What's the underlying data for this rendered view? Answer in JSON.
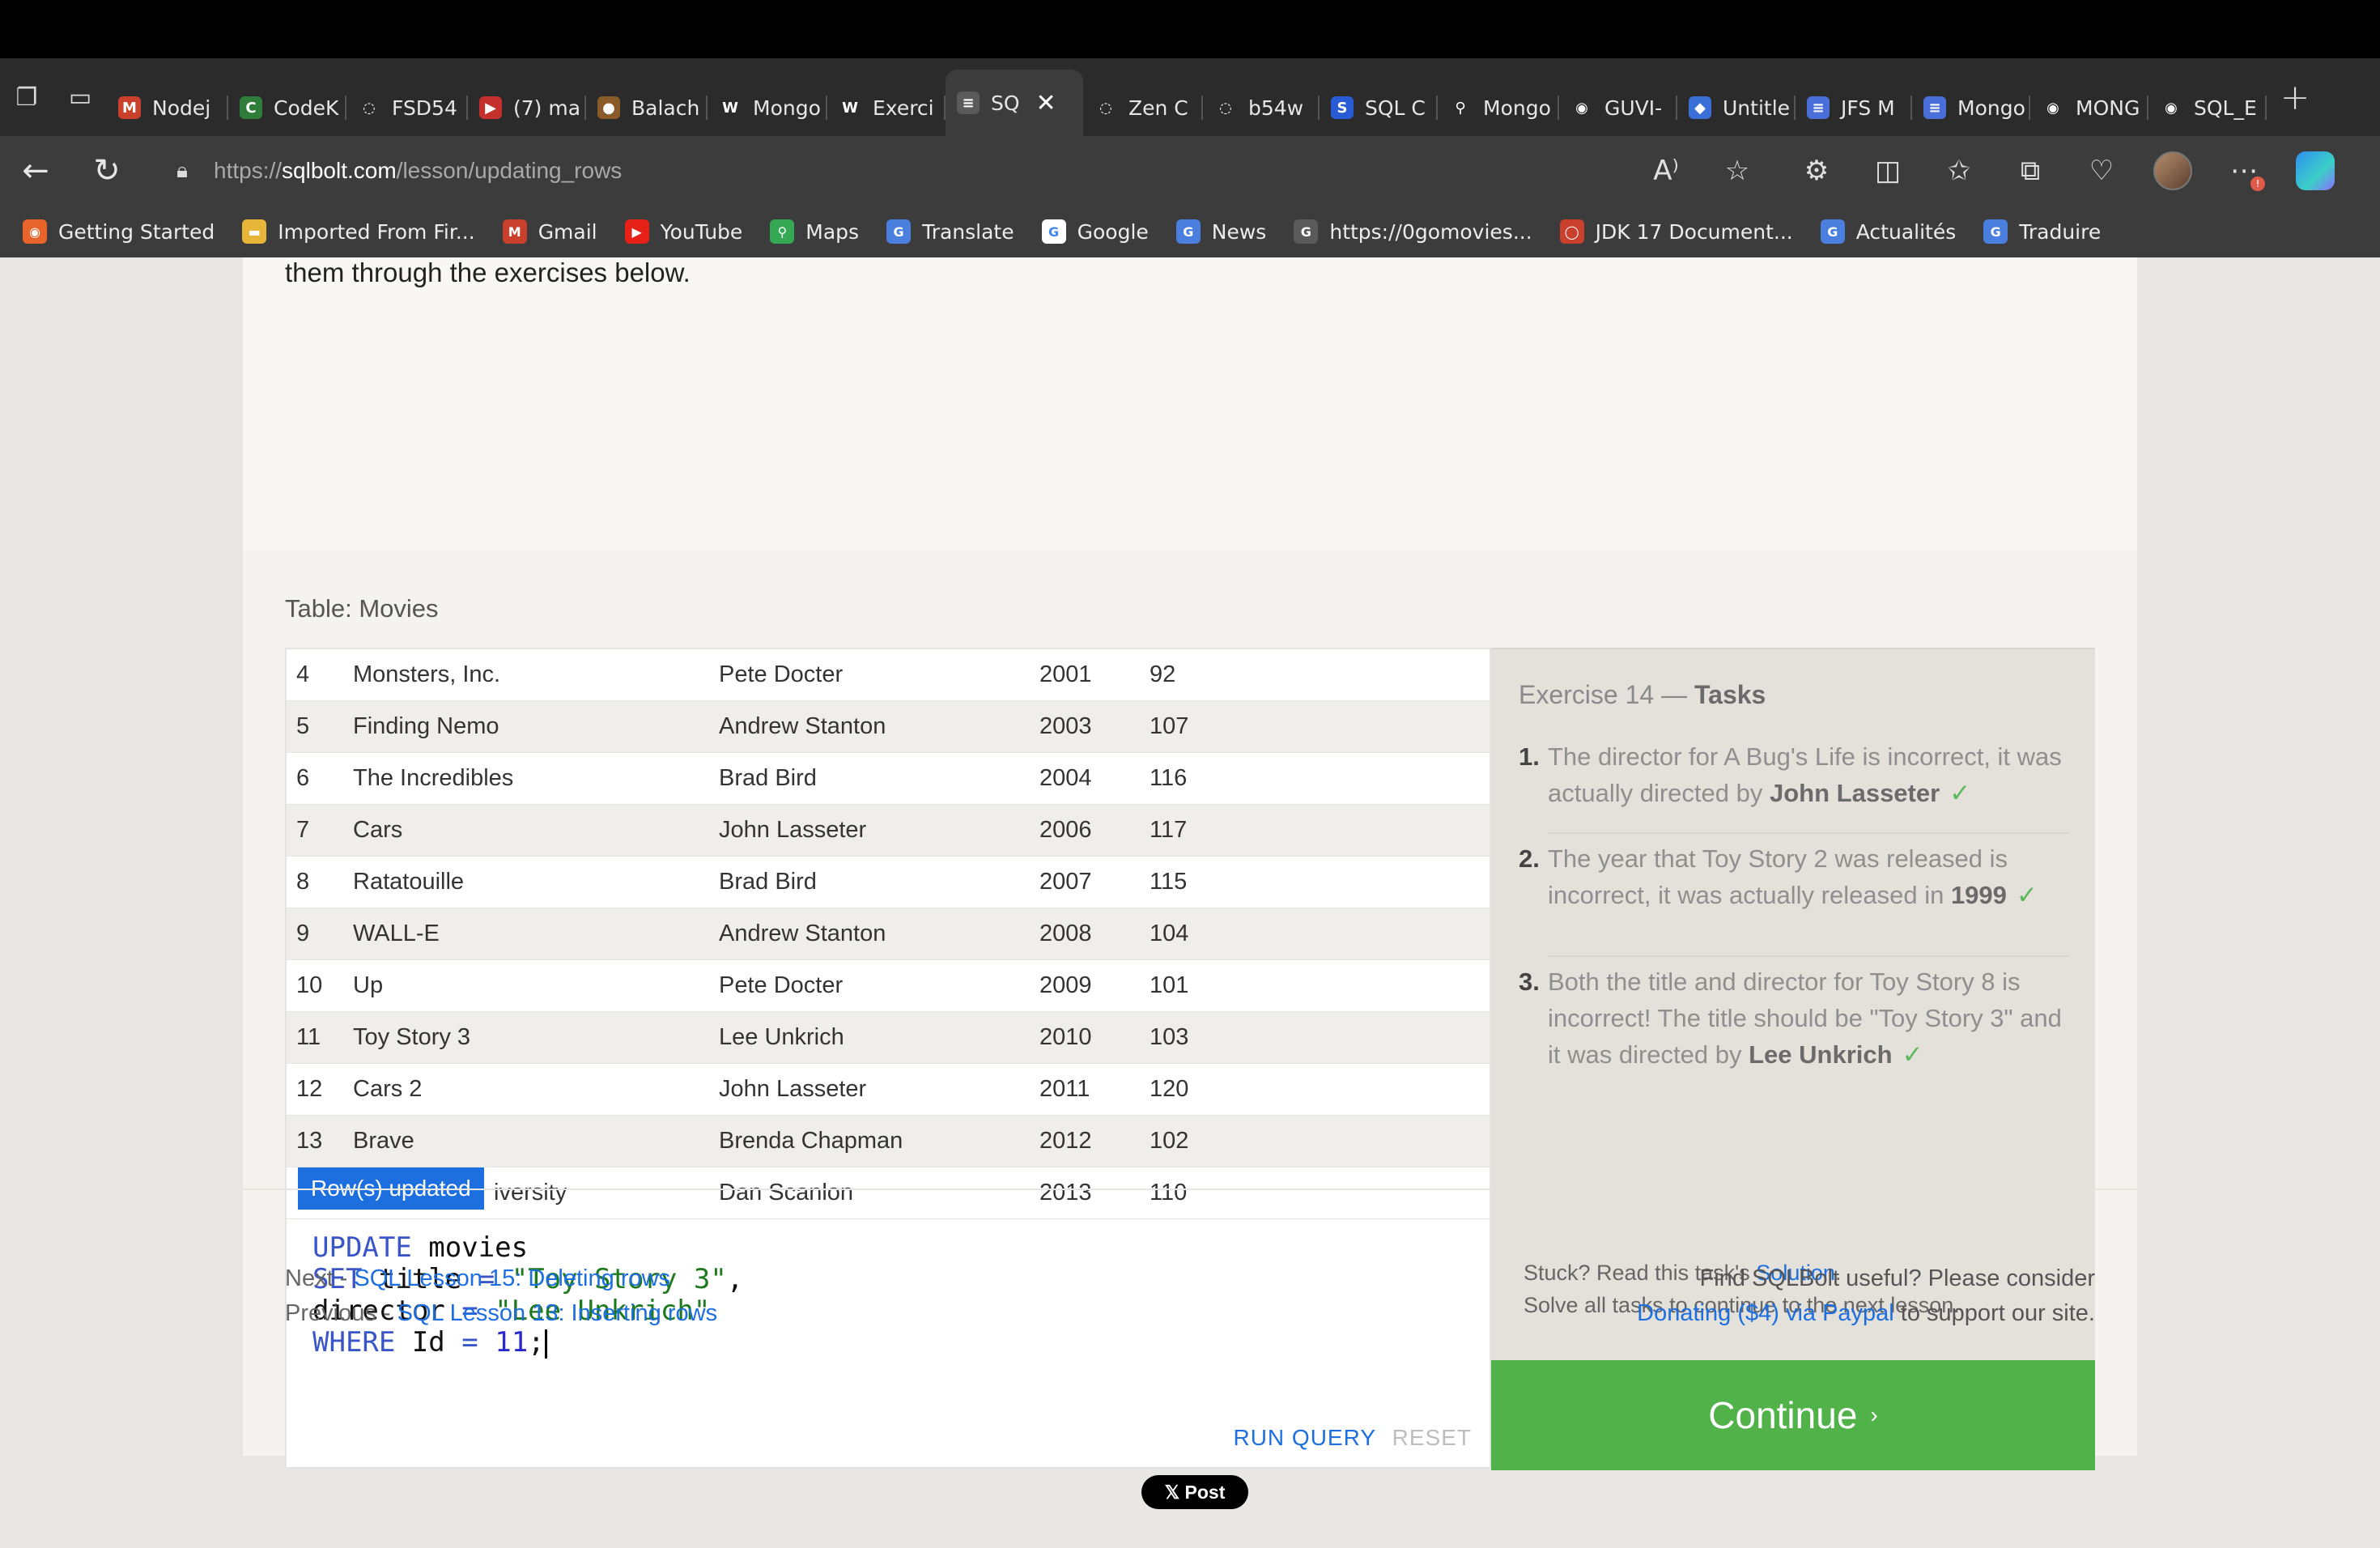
{
  "browser": {
    "tabs": [
      {
        "label": "Nodej",
        "fav_color": "#c9402d",
        "fav_glyph": "M"
      },
      {
        "label": "CodeK",
        "fav_color": "#2f7d3a",
        "fav_glyph": "C"
      },
      {
        "label": "FSD54",
        "fav_color": "#2b2b2b",
        "fav_glyph": "◌"
      },
      {
        "label": "(7) ma",
        "fav_color": "#c4302b",
        "fav_glyph": "▶"
      },
      {
        "label": "Balach",
        "fav_color": "#8a5a2b",
        "fav_glyph": "●"
      },
      {
        "label": "Mongo",
        "fav_color": "#2b2b2b",
        "fav_glyph": "W"
      },
      {
        "label": "Exerci",
        "fav_color": "#2b2b2b",
        "fav_glyph": "W"
      },
      {
        "label": "SQ",
        "fav_color": "#5a5a5a",
        "fav_glyph": "≡",
        "active": true
      },
      {
        "label": "Zen C",
        "fav_color": "#2b2b2b",
        "fav_glyph": "◌"
      },
      {
        "label": "b54w",
        "fav_color": "#2b2b2b",
        "fav_glyph": "◌"
      },
      {
        "label": "SQL C",
        "fav_color": "#2a5bd7",
        "fav_glyph": "S"
      },
      {
        "label": "Mongo",
        "fav_color": "#2b2b2b",
        "fav_glyph": "⚲"
      },
      {
        "label": "GUVI-",
        "fav_color": "#2b2b2b",
        "fav_glyph": "◉"
      },
      {
        "label": "Untitle",
        "fav_color": "#3b6fd8",
        "fav_glyph": "◆"
      },
      {
        "label": "JFS M",
        "fav_color": "#4a6fd8",
        "fav_glyph": "≡"
      },
      {
        "label": "Mongo",
        "fav_color": "#4a6fd8",
        "fav_glyph": "≡"
      },
      {
        "label": "MONG",
        "fav_color": "#2b2b2b",
        "fav_glyph": "◉"
      },
      {
        "label": "SQL_E",
        "fav_color": "#2b2b2b",
        "fav_glyph": "◉"
      }
    ],
    "url": {
      "scheme": "https://",
      "host": "sqlbolt.com",
      "path": "/lesson/updating_rows"
    },
    "bookmarks": [
      {
        "label": "Getting Started",
        "color": "#e8642b",
        "glyph": "◉"
      },
      {
        "label": "Imported From Fir...",
        "color": "#e8b53b",
        "glyph": "▬"
      },
      {
        "label": "Gmail",
        "color": "#c9402d",
        "glyph": "M"
      },
      {
        "label": "YouTube",
        "color": "#e62117",
        "glyph": "▶"
      },
      {
        "label": "Maps",
        "color": "#34a853",
        "glyph": "⚲"
      },
      {
        "label": "Translate",
        "color": "#4a7fe0",
        "glyph": "G"
      },
      {
        "label": "Google",
        "color": "#ffffff",
        "glyph": "G"
      },
      {
        "label": "News",
        "color": "#4a7fe0",
        "glyph": "G"
      },
      {
        "label": "https://0gomovies...",
        "color": "#5a5a5a",
        "glyph": "G"
      },
      {
        "label": "JDK 17 Document...",
        "color": "#c9402d",
        "glyph": "◯"
      },
      {
        "label": "Actualités",
        "color": "#4a7fe0",
        "glyph": "G"
      },
      {
        "label": "Traduire",
        "color": "#4a7fe0",
        "glyph": "G"
      }
    ]
  },
  "page": {
    "intro_text": "them through the exercises below.",
    "table_caption": "Table: Movies",
    "rows": [
      {
        "id": "4",
        "title": "Monsters, Inc.",
        "director": "Pete Docter",
        "year": "2001",
        "length": "92"
      },
      {
        "id": "5",
        "title": "Finding Nemo",
        "director": "Andrew Stanton",
        "year": "2003",
        "length": "107"
      },
      {
        "id": "6",
        "title": "The Incredibles",
        "director": "Brad Bird",
        "year": "2004",
        "length": "116"
      },
      {
        "id": "7",
        "title": "Cars",
        "director": "John Lasseter",
        "year": "2006",
        "length": "117"
      },
      {
        "id": "8",
        "title": "Ratatouille",
        "director": "Brad Bird",
        "year": "2007",
        "length": "115"
      },
      {
        "id": "9",
        "title": "WALL-E",
        "director": "Andrew Stanton",
        "year": "2008",
        "length": "104"
      },
      {
        "id": "10",
        "title": "Up",
        "director": "Pete Docter",
        "year": "2009",
        "length": "101"
      },
      {
        "id": "11",
        "title": "Toy Story 3",
        "director": "Lee Unkrich",
        "year": "2010",
        "length": "103"
      },
      {
        "id": "12",
        "title": "Cars 2",
        "director": "John Lasseter",
        "year": "2011",
        "length": "120"
      },
      {
        "id": "13",
        "title": "Brave",
        "director": "Brenda Chapman",
        "year": "2012",
        "length": "102"
      },
      {
        "id": "",
        "title": "iversity",
        "director": "Dan Scanlon",
        "year": "2013",
        "length": "110"
      }
    ],
    "toast": "Row(s) updated",
    "query_lines": [
      [
        {
          "t": "UPDATE",
          "c": "kw"
        },
        {
          "t": " movies",
          "c": ""
        }
      ],
      [
        {
          "t": "SET",
          "c": "kw"
        },
        {
          "t": " title ",
          "c": ""
        },
        {
          "t": "=",
          "c": "kw"
        },
        {
          "t": " ",
          "c": ""
        },
        {
          "t": "\"Toy Story 3\"",
          "c": "str"
        },
        {
          "t": ",",
          "c": ""
        }
      ],
      [
        {
          "t": "director ",
          "c": ""
        },
        {
          "t": "=",
          "c": "kw"
        },
        {
          "t": " ",
          "c": ""
        },
        {
          "t": "\"Lee Unkrich\"",
          "c": "str"
        }
      ],
      [
        {
          "t": "WHERE",
          "c": "kw"
        },
        {
          "t": " Id ",
          "c": ""
        },
        {
          "t": "=",
          "c": "kw"
        },
        {
          "t": " ",
          "c": ""
        },
        {
          "t": "11",
          "c": "num"
        },
        {
          "t": ";",
          "c": ""
        }
      ]
    ],
    "run_label": "RUN QUERY",
    "reset_label": "RESET",
    "tasks_title_prefix": "Exercise 14 — ",
    "tasks_title_bold": "Tasks",
    "tasks": [
      {
        "num": "1.",
        "text": "The director for A Bug's Life is incorrect, it was actually directed by ",
        "bold": "John Lasseter",
        "check": "✓"
      },
      {
        "num": "2.",
        "text": "The year that Toy Story 2 was released is incorrect, it was actually released in ",
        "bold": "1999",
        "check": "✓"
      },
      {
        "num": "3.",
        "text": "Both the title and director for Toy Story 8 is incorrect! The title should be \"Toy Story 3\" and it was directed by ",
        "bold": "Lee Unkrich",
        "check": "✓"
      }
    ],
    "stuck_prefix": "Stuck? Read this task's ",
    "stuck_link": "Solution",
    "stuck_suffix": ".",
    "solve_all": "Solve all tasks to continue to the next lesson.",
    "continue_label": "Continue",
    "continue_chevron": "›",
    "next_prefix": "Next - ",
    "next_link": "SQL Lesson 15: Deleting rows",
    "prev_prefix": "Previous - ",
    "prev_link": "SQL Lesson 13: Inserting rows",
    "donate_line1": "Find SQLBolt useful? Please consider",
    "donate_link": "Donating ($4) via Paypal",
    "donate_suffix": " to support our site.",
    "xpost_label": "𝕏 Post"
  }
}
